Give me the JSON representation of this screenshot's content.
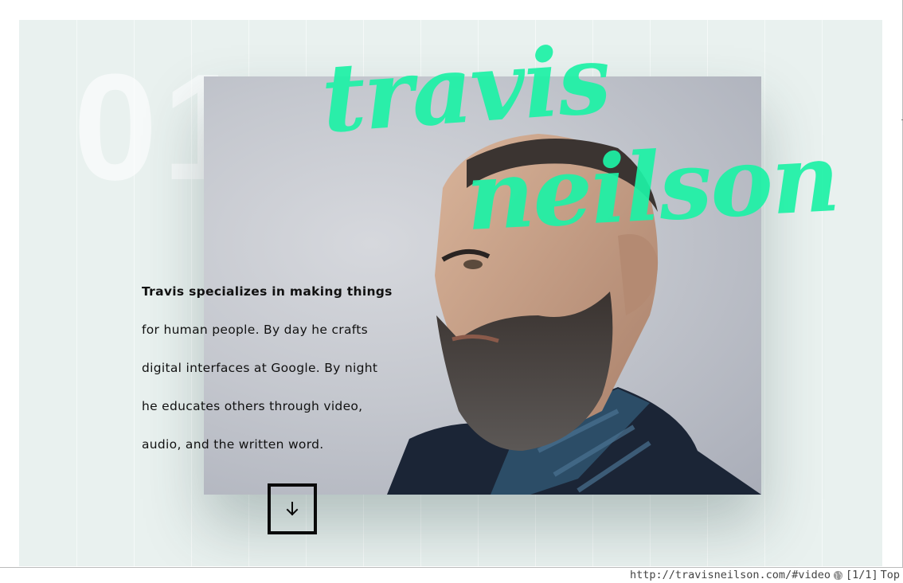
{
  "hero": {
    "section_number": "01",
    "first_name": "travis",
    "last_name": "neilson",
    "bio_lines": [
      "Travis specializes in making things",
      "for human people. By day he crafts",
      "digital interfaces at Google. By night",
      "he educates others through video,",
      "audio, and the written word."
    ],
    "scroll_icon": "arrow-down-icon"
  },
  "status_bar": {
    "url": "http://travisneilson.com/#video",
    "icon": "globe-icon",
    "position": "[1/1]",
    "scroll": "Top"
  },
  "colors": {
    "accent": "#1df2a6",
    "background": "#e9f1ef",
    "text": "#111111"
  }
}
